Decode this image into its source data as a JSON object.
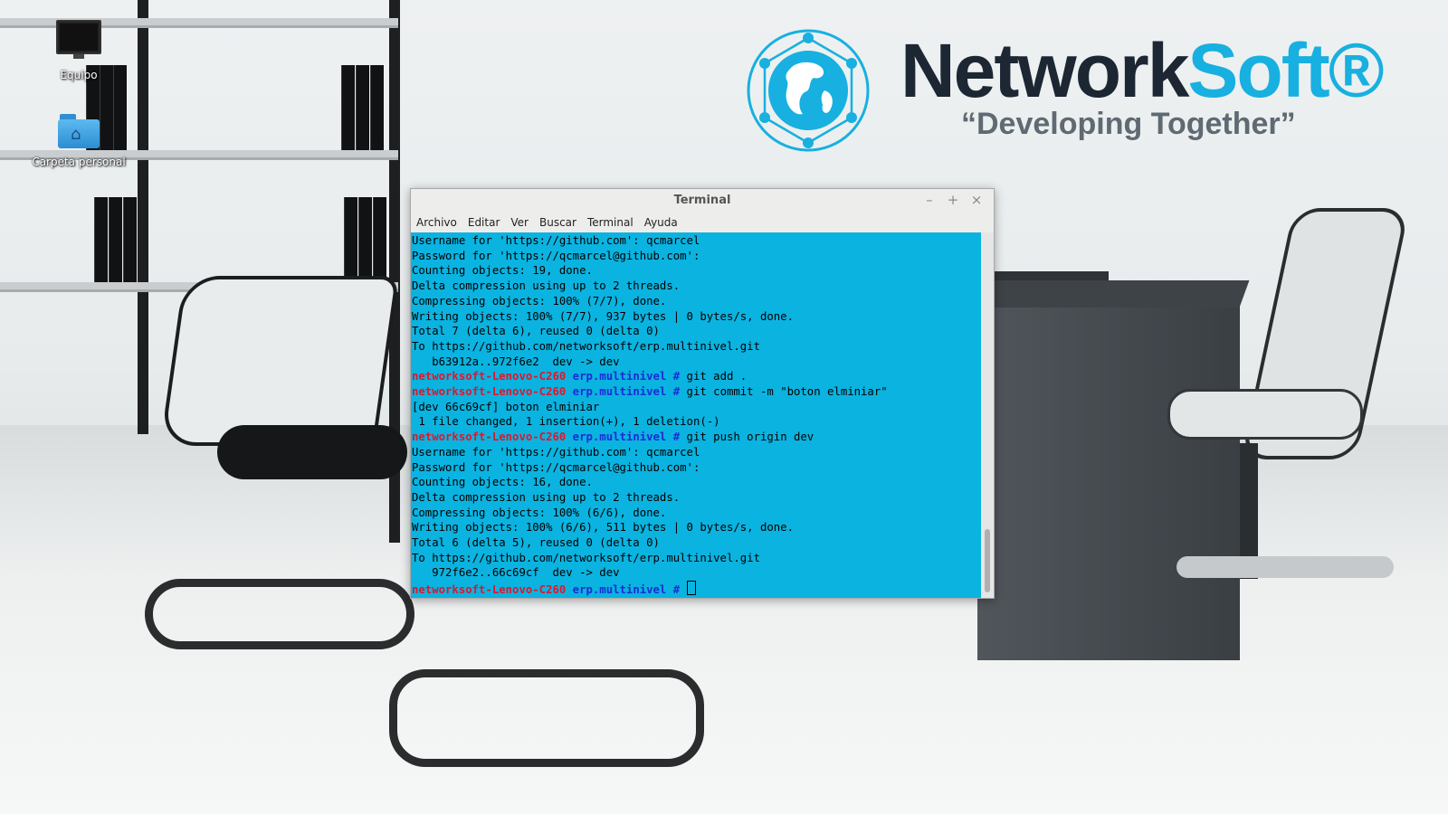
{
  "desktop": {
    "icons": [
      {
        "label": "Equipo",
        "icon": "computer-icon"
      },
      {
        "label": "Carpeta personal",
        "icon": "home-folder-icon"
      }
    ]
  },
  "brand": {
    "name_part1": "Network",
    "name_part2": "Soft®",
    "tagline": "“Developing Together”",
    "colors": {
      "dark": "#1c2733",
      "accent": "#17b0e0",
      "tagline": "#5f6a72"
    }
  },
  "terminal": {
    "title": "Terminal",
    "window_controls": {
      "minimize": "–",
      "maximize": "+",
      "close": "×"
    },
    "menu": [
      "Archivo",
      "Editar",
      "Ver",
      "Buscar",
      "Terminal",
      "Ayuda"
    ],
    "colors": {
      "background": "#0bb3e0",
      "host": "#e0162b",
      "path": "#1c2bd6",
      "text": "#000000"
    },
    "prompt": {
      "host": "networksoft-Lenovo-C260",
      "path": "erp.multinivel",
      "symbol": "#"
    },
    "lines": [
      {
        "type": "out",
        "text": "Username for 'https://github.com': qcmarcel"
      },
      {
        "type": "out",
        "text": "Password for 'https://qcmarcel@github.com':"
      },
      {
        "type": "out",
        "text": "Counting objects: 19, done."
      },
      {
        "type": "out",
        "text": "Delta compression using up to 2 threads."
      },
      {
        "type": "out",
        "text": "Compressing objects: 100% (7/7), done."
      },
      {
        "type": "out",
        "text": "Writing objects: 100% (7/7), 937 bytes | 0 bytes/s, done."
      },
      {
        "type": "out",
        "text": "Total 7 (delta 6), reused 0 (delta 0)"
      },
      {
        "type": "out",
        "text": "To https://github.com/networksoft/erp.multinivel.git"
      },
      {
        "type": "out",
        "text": "   b63912a..972f6e2  dev -> dev"
      },
      {
        "type": "cmd",
        "text": "git add ."
      },
      {
        "type": "cmd",
        "text": "git commit -m \"boton elminiar\""
      },
      {
        "type": "out",
        "text": "[dev 66c69cf] boton elminiar"
      },
      {
        "type": "out",
        "text": " 1 file changed, 1 insertion(+), 1 deletion(-)"
      },
      {
        "type": "cmd",
        "text": "git push origin dev"
      },
      {
        "type": "out",
        "text": "Username for 'https://github.com': qcmarcel"
      },
      {
        "type": "out",
        "text": "Password for 'https://qcmarcel@github.com':"
      },
      {
        "type": "out",
        "text": "Counting objects: 16, done."
      },
      {
        "type": "out",
        "text": "Delta compression using up to 2 threads."
      },
      {
        "type": "out",
        "text": "Compressing objects: 100% (6/6), done."
      },
      {
        "type": "out",
        "text": "Writing objects: 100% (6/6), 511 bytes | 0 bytes/s, done."
      },
      {
        "type": "out",
        "text": "Total 6 (delta 5), reused 0 (delta 0)"
      },
      {
        "type": "out",
        "text": "To https://github.com/networksoft/erp.multinivel.git"
      },
      {
        "type": "out",
        "text": "   972f6e2..66c69cf  dev -> dev"
      },
      {
        "type": "prompt",
        "text": ""
      }
    ]
  }
}
